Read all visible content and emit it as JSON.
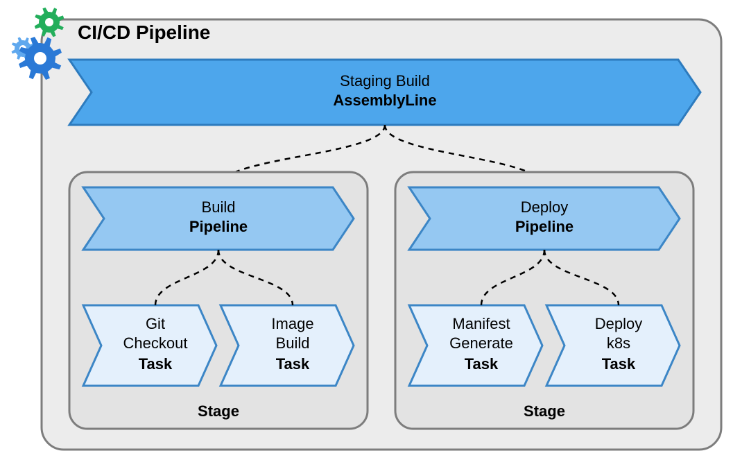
{
  "title": "CI/CD Pipeline",
  "assembly": {
    "line1": "Staging Build",
    "line2": "AssemblyLine"
  },
  "stages": [
    {
      "pipeline": {
        "line1": "Build",
        "line2": "Pipeline"
      },
      "tasks": [
        {
          "line1": "Git",
          "line2": "Checkout",
          "type": "Task"
        },
        {
          "line1": "Image",
          "line2": "Build",
          "type": "Task"
        }
      ],
      "label": "Stage"
    },
    {
      "pipeline": {
        "line1": "Deploy",
        "line2": "Pipeline"
      },
      "tasks": [
        {
          "line1": "Manifest",
          "line2": "Generate",
          "type": "Task"
        },
        {
          "line1": "Deploy",
          "line2": "k8s",
          "type": "Task"
        }
      ],
      "label": "Stage"
    }
  ],
  "colors": {
    "outerFill": "#ECECEC",
    "outerStroke": "#7D7D7D",
    "innerFill": "#E3E3E3",
    "assemblyFill": "#4DA6EC",
    "assemblyStroke": "#2D7BBE",
    "pipelineFill": "#95C8F2",
    "pipelineStroke": "#3C86C6",
    "taskFill": "#E4F0FC",
    "taskStroke": "#3C86C6",
    "gearBlue": "#2A79D6",
    "gearGreen": "#23AE5B",
    "gearLight": "#5FA8EE"
  }
}
